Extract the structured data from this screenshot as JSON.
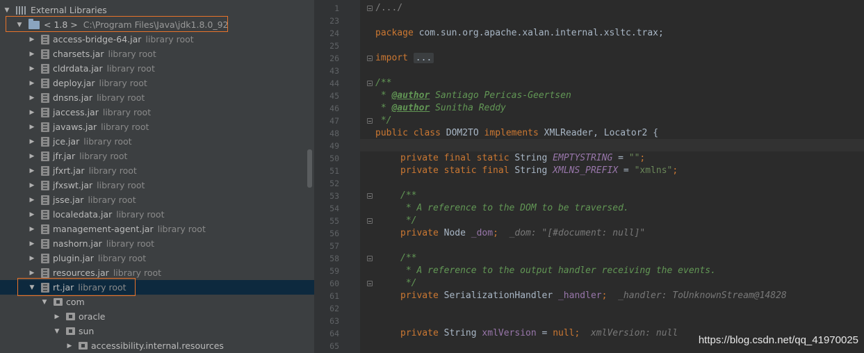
{
  "tree": {
    "header_label": "External Libraries",
    "sdk": {
      "label": "< 1.8 >",
      "path": "C:\\Program Files\\Java\\jdk1.8.0_92"
    },
    "jars": [
      {
        "name": "access-bridge-64.jar",
        "kind": "library root"
      },
      {
        "name": "charsets.jar",
        "kind": "library root"
      },
      {
        "name": "cldrdata.jar",
        "kind": "library root"
      },
      {
        "name": "deploy.jar",
        "kind": "library root"
      },
      {
        "name": "dnsns.jar",
        "kind": "library root"
      },
      {
        "name": "jaccess.jar",
        "kind": "library root"
      },
      {
        "name": "javaws.jar",
        "kind": "library root"
      },
      {
        "name": "jce.jar",
        "kind": "library root"
      },
      {
        "name": "jfr.jar",
        "kind": "library root"
      },
      {
        "name": "jfxrt.jar",
        "kind": "library root"
      },
      {
        "name": "jfxswt.jar",
        "kind": "library root"
      },
      {
        "name": "jsse.jar",
        "kind": "library root"
      },
      {
        "name": "localedata.jar",
        "kind": "library root"
      },
      {
        "name": "management-agent.jar",
        "kind": "library root"
      },
      {
        "name": "nashorn.jar",
        "kind": "library root"
      },
      {
        "name": "plugin.jar",
        "kind": "library root"
      },
      {
        "name": "resources.jar",
        "kind": "library root"
      }
    ],
    "selected_jar": {
      "name": "rt.jar",
      "kind": "library root"
    },
    "packages": [
      {
        "name": "com"
      },
      {
        "name": "oracle"
      },
      {
        "name": "sun"
      },
      {
        "name": "accessibility.internal.resources"
      }
    ]
  },
  "editor": {
    "line_numbers": [
      "1",
      "23",
      "24",
      "25",
      "26",
      "43",
      "44",
      "45",
      "46",
      "47",
      "48",
      "49",
      "50",
      "51",
      "52",
      "53",
      "54",
      "55",
      "56",
      "57",
      "58",
      "59",
      "60",
      "61",
      "62",
      "63",
      "64",
      "65"
    ],
    "code": {
      "l1": "/.../",
      "l24_kw": "package",
      "l24_rest": " com.sun.org.apache.xalan.internal.xsltc.trax;",
      "l26_kw": "import",
      "l26_fold": "...",
      "l44": "/**",
      "l45_star": " * ",
      "l45_tag": "@author",
      "l45_text": " Santiago Pericas-Geertsen",
      "l46_star": " * ",
      "l46_tag": "@author",
      "l46_text": " Sunitha Reddy",
      "l47": " */",
      "l48_kw1": "public class",
      "l48_name": " DOM2TO ",
      "l48_kw2": "implements",
      "l48_rest": " XMLReader, Locator2 {",
      "l50_kw": "private final static",
      "l50_type": " String ",
      "l50_field": "EMPTYSTRING",
      "l50_eq": " = ",
      "l50_str": "\"\"",
      "l50_end": ";",
      "l51_kw": "private static final",
      "l51_type": " String ",
      "l51_field": "XMLNS_PREFIX",
      "l51_eq": " = ",
      "l51_str": "\"xmlns\"",
      "l51_end": ";",
      "l53": "/**",
      "l54": " * A reference to the DOM to be traversed.",
      "l55": " */",
      "l56_kw": "private",
      "l56_type": " Node ",
      "l56_field": "_dom",
      "l56_end": ";",
      "l56_hint": "_dom: \"[#document: null]\"",
      "l58": "/**",
      "l59": " * A reference to the output handler receiving the events.",
      "l60": " */",
      "l61_kw": "private",
      "l61_type": " SerializationHandler ",
      "l61_field": "_handler",
      "l61_end": ";",
      "l61_hint": "_handler: ToUnknownStream@14828",
      "l64_kw": "private",
      "l64_type": " String ",
      "l64_field": "xmlVersion",
      "l64_eq": " = ",
      "l64_null": "null",
      "l64_end": ";",
      "l64_hint": "xmlVersion: null"
    }
  },
  "watermark": "https://blog.csdn.net/qq_41970025",
  "colors": {
    "highlight_box": "#e8732a",
    "keyword": "#cc7832",
    "doc_comment": "#629755",
    "field": "#9876aa",
    "string": "#6a8759",
    "tree_selection": "#0d293e"
  }
}
